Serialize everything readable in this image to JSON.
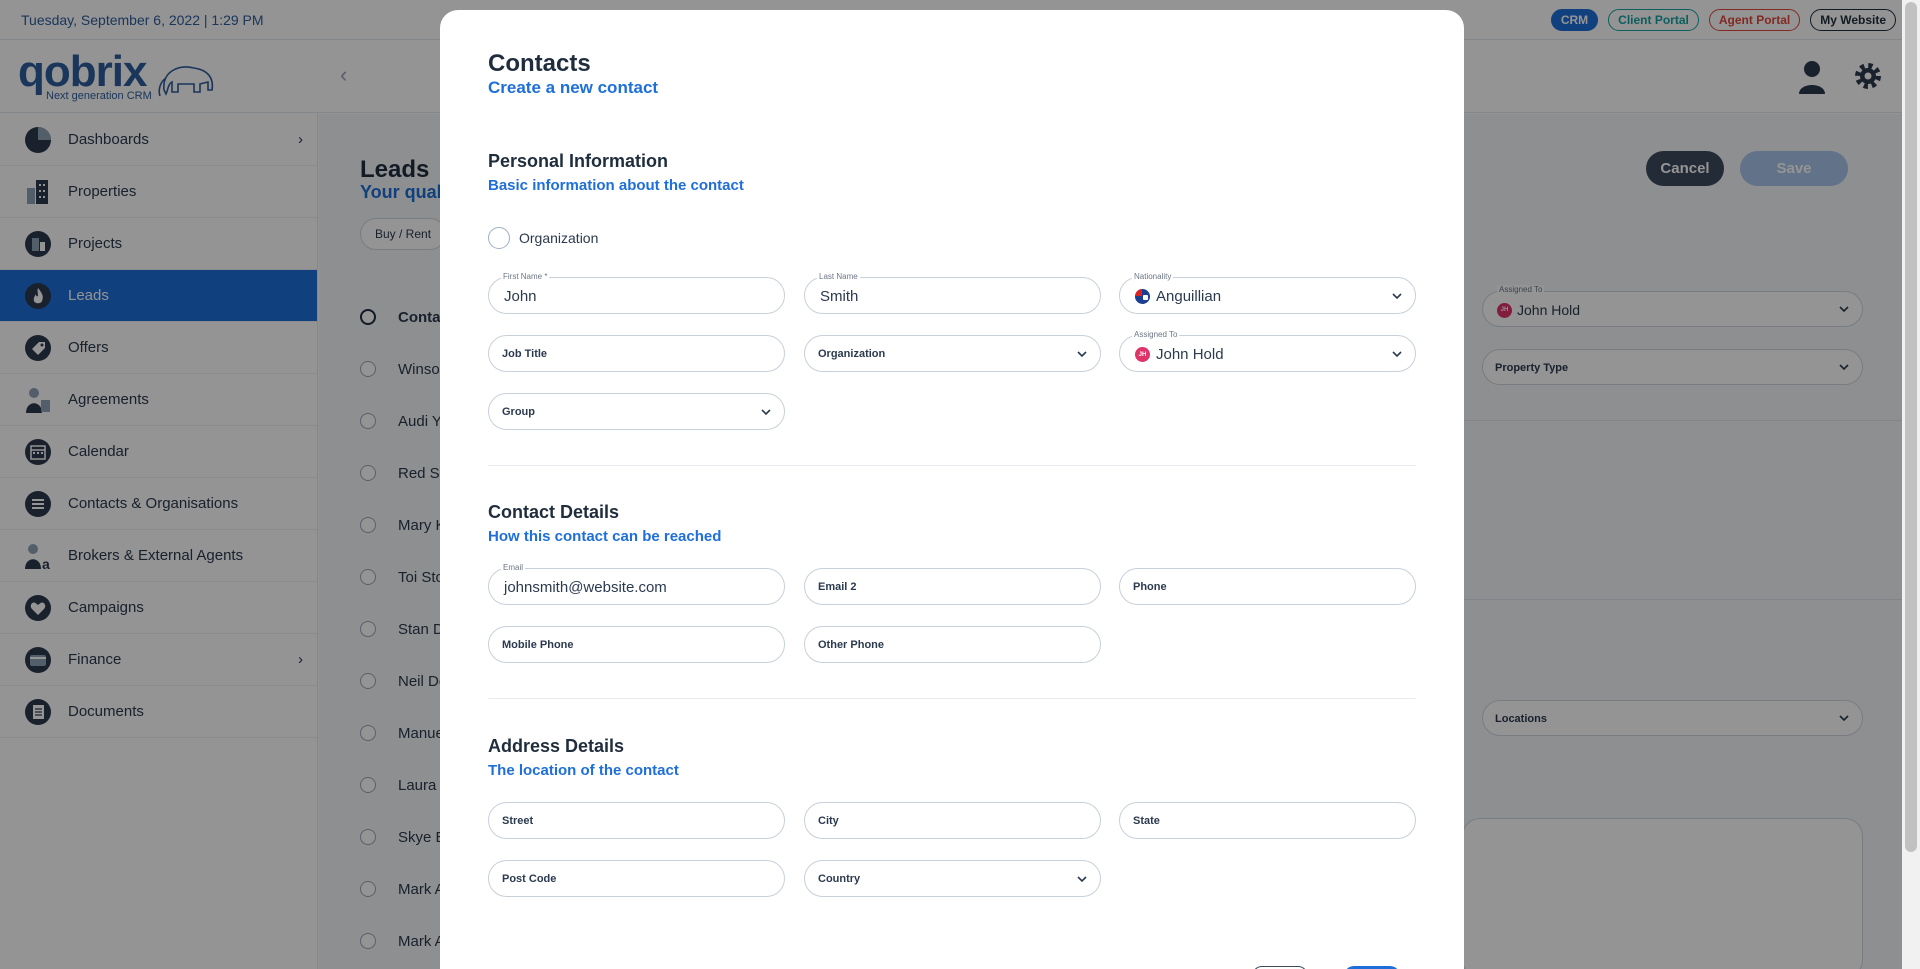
{
  "topbar": {
    "date": "Tuesday, September 6, 2022 | 1:29 PM",
    "pills": [
      "CRM",
      "Client Portal",
      "Agent Portal",
      "My Website"
    ]
  },
  "logo": {
    "brand": "qobrix",
    "tagline": "Next generation CRM"
  },
  "sidebar": {
    "items": [
      {
        "label": "Dashboards",
        "icon": "pie-chart-icon",
        "has_submenu": true
      },
      {
        "label": "Properties",
        "icon": "building-icon"
      },
      {
        "label": "Projects",
        "icon": "project-icon"
      },
      {
        "label": "Leads",
        "icon": "flame-icon",
        "active": true
      },
      {
        "label": "Offers",
        "icon": "tag-icon"
      },
      {
        "label": "Agreements",
        "icon": "agreement-icon"
      },
      {
        "label": "Calendar",
        "icon": "calendar-icon"
      },
      {
        "label": "Contacts & Organisations",
        "icon": "contacts-icon"
      },
      {
        "label": "Brokers & External Agents",
        "icon": "broker-icon"
      },
      {
        "label": "Campaigns",
        "icon": "heart-icon"
      },
      {
        "label": "Finance",
        "icon": "finance-icon",
        "has_submenu": true
      },
      {
        "label": "Documents",
        "icon": "documents-icon"
      }
    ]
  },
  "leads": {
    "title": "Leads",
    "subtitle": "Your qual",
    "chip": "Buy / Rent",
    "header_row": "Conta",
    "rows": [
      "Winso",
      "Audi Y",
      "Red S",
      "Mary K",
      "Toi Sto",
      "Stan D",
      "Neil De",
      "Manue",
      "Laura",
      "Skye E",
      "Mark A",
      "Mark A"
    ],
    "cancel": "Cancel",
    "save": "Save",
    "assigned_label": "Assigned To",
    "assigned_value": "John Hold",
    "property_type": "Property Type",
    "locations": "Locations"
  },
  "modal": {
    "title": "Contacts",
    "subtitle": "Create a new contact",
    "personal": {
      "title": "Personal Information",
      "subtitle": "Basic information about the contact",
      "organization_toggle": "Organization",
      "first_name_label": "First Name *",
      "first_name": "John",
      "last_name_label": "Last Name",
      "last_name": "Smith",
      "nationality_label": "Nationality",
      "nationality": "Anguillian",
      "job_title": "Job Title",
      "organization": "Organization",
      "assigned_label": "Assigned To",
      "assigned": "John Hold",
      "assigned_initials": "JH",
      "group": "Group"
    },
    "contact": {
      "title": "Contact Details",
      "subtitle": "How this contact can be reached",
      "email_label": "Email",
      "email": "johnsmith@website.com",
      "email2": "Email 2",
      "phone": "Phone",
      "mobile": "Mobile Phone",
      "other_phone": "Other Phone"
    },
    "address": {
      "title": "Address Details",
      "subtitle": "The location of the contact",
      "street": "Street",
      "city": "City",
      "state": "State",
      "post_code": "Post Code",
      "country": "Country"
    }
  },
  "colors": {
    "primary": "#1e6fd9",
    "dark": "#1f2d3d",
    "danger": "#e0483d",
    "teal": "#17a2a2"
  }
}
